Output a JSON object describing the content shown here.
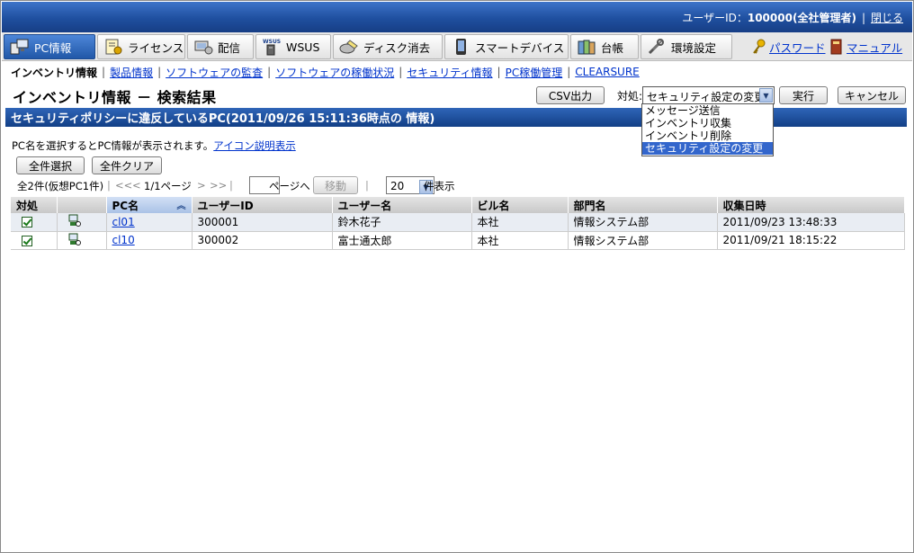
{
  "header": {
    "user_label": "ユーザーID：",
    "user_value": "100000(全社管理者)",
    "close_link": "閉じる"
  },
  "tabs": [
    {
      "label": "PC情報",
      "icon": "pc-info-icon",
      "active": true
    },
    {
      "label": "ライセンス",
      "icon": "license-icon"
    },
    {
      "label": "配信",
      "icon": "delivery-icon"
    },
    {
      "label": "WSUS",
      "icon": "wsus-icon"
    },
    {
      "label": "ディスク消去",
      "icon": "disk-erase-icon"
    },
    {
      "label": "スマートデバイス",
      "icon": "smart-device-icon"
    },
    {
      "label": "台帳",
      "icon": "ledger-icon"
    },
    {
      "label": "環境設定",
      "icon": "settings-icon"
    }
  ],
  "right_links": {
    "password": "パスワード",
    "manual": "マニュアル"
  },
  "subnav": {
    "current": "インベントリ情報",
    "links": [
      "製品情報",
      "ソフトウェアの監査",
      "ソフトウェアの稼働状況",
      "セキュリティ情報",
      "PC稼働管理",
      "CLEARSURE"
    ]
  },
  "title": "インベントリ情報 － 検索結果",
  "actions": {
    "csv_button": "CSV出力",
    "action_label": "対処:",
    "action_selected": "セキュリティ設定の変更",
    "action_options": [
      "メッセージ送信",
      "インベントリ収集",
      "インベントリ削除",
      "セキュリティ設定の変更"
    ],
    "execute_button": "実行",
    "cancel_button": "キャンセル"
  },
  "section_title": "セキュリティポリシーに違反しているPC(2011/09/26 15:11:36時点の 情報)",
  "hint": {
    "text": "PC名を選択するとPC情報が表示されます。",
    "link": "アイコン説明表示"
  },
  "buttons": {
    "select_all": "全件選択",
    "clear_all": "全件クリア"
  },
  "pager": {
    "count": "全2件(仮想PC1件)",
    "first": "<<",
    "prev": "<",
    "page": "1/1ページ",
    "next": ">",
    "last": ">>",
    "goto_label": "ページへ",
    "move_button": "移動",
    "per_page": "20",
    "per_page_label": "件表示"
  },
  "table": {
    "columns": [
      "対処",
      "",
      "PC名",
      "ユーザーID",
      "ユーザー名",
      "ビル名",
      "部門名",
      "収集日時"
    ],
    "rows": [
      {
        "pc": "cl01",
        "user_id": "300001",
        "user_name": "鈴木花子",
        "building": "本社",
        "dept": "情報システム部",
        "date": "2011/09/23 13:48:33",
        "checked": true
      },
      {
        "pc": "cl10",
        "user_id": "300002",
        "user_name": "富士通太郎",
        "building": "本社",
        "dept": "情報システム部",
        "date": "2011/09/21 18:15:22",
        "checked": true
      }
    ]
  },
  "colors": {
    "header_blue": "#1f4f9f",
    "link": "#0033cc",
    "selected_option": "#3366cc"
  }
}
